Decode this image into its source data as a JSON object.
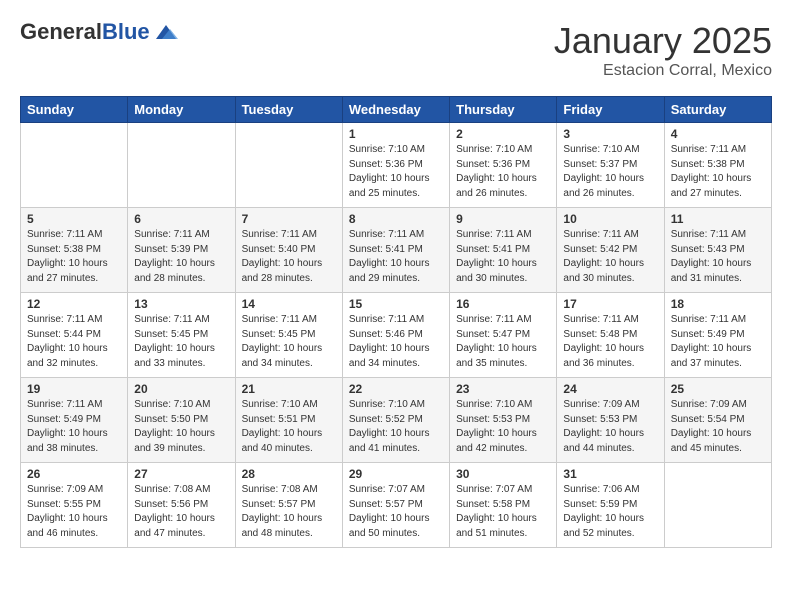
{
  "logo": {
    "general": "General",
    "blue": "Blue"
  },
  "header": {
    "title": "January 2025",
    "subtitle": "Estacion Corral, Mexico"
  },
  "weekdays": [
    "Sunday",
    "Monday",
    "Tuesday",
    "Wednesday",
    "Thursday",
    "Friday",
    "Saturday"
  ],
  "weeks": [
    [
      {
        "day": "",
        "sunrise": "",
        "sunset": "",
        "daylight": ""
      },
      {
        "day": "",
        "sunrise": "",
        "sunset": "",
        "daylight": ""
      },
      {
        "day": "",
        "sunrise": "",
        "sunset": "",
        "daylight": ""
      },
      {
        "day": "1",
        "sunrise": "Sunrise: 7:10 AM",
        "sunset": "Sunset: 5:36 PM",
        "daylight": "Daylight: 10 hours and 25 minutes."
      },
      {
        "day": "2",
        "sunrise": "Sunrise: 7:10 AM",
        "sunset": "Sunset: 5:36 PM",
        "daylight": "Daylight: 10 hours and 26 minutes."
      },
      {
        "day": "3",
        "sunrise": "Sunrise: 7:10 AM",
        "sunset": "Sunset: 5:37 PM",
        "daylight": "Daylight: 10 hours and 26 minutes."
      },
      {
        "day": "4",
        "sunrise": "Sunrise: 7:11 AM",
        "sunset": "Sunset: 5:38 PM",
        "daylight": "Daylight: 10 hours and 27 minutes."
      }
    ],
    [
      {
        "day": "5",
        "sunrise": "Sunrise: 7:11 AM",
        "sunset": "Sunset: 5:38 PM",
        "daylight": "Daylight: 10 hours and 27 minutes."
      },
      {
        "day": "6",
        "sunrise": "Sunrise: 7:11 AM",
        "sunset": "Sunset: 5:39 PM",
        "daylight": "Daylight: 10 hours and 28 minutes."
      },
      {
        "day": "7",
        "sunrise": "Sunrise: 7:11 AM",
        "sunset": "Sunset: 5:40 PM",
        "daylight": "Daylight: 10 hours and 28 minutes."
      },
      {
        "day": "8",
        "sunrise": "Sunrise: 7:11 AM",
        "sunset": "Sunset: 5:41 PM",
        "daylight": "Daylight: 10 hours and 29 minutes."
      },
      {
        "day": "9",
        "sunrise": "Sunrise: 7:11 AM",
        "sunset": "Sunset: 5:41 PM",
        "daylight": "Daylight: 10 hours and 30 minutes."
      },
      {
        "day": "10",
        "sunrise": "Sunrise: 7:11 AM",
        "sunset": "Sunset: 5:42 PM",
        "daylight": "Daylight: 10 hours and 30 minutes."
      },
      {
        "day": "11",
        "sunrise": "Sunrise: 7:11 AM",
        "sunset": "Sunset: 5:43 PM",
        "daylight": "Daylight: 10 hours and 31 minutes."
      }
    ],
    [
      {
        "day": "12",
        "sunrise": "Sunrise: 7:11 AM",
        "sunset": "Sunset: 5:44 PM",
        "daylight": "Daylight: 10 hours and 32 minutes."
      },
      {
        "day": "13",
        "sunrise": "Sunrise: 7:11 AM",
        "sunset": "Sunset: 5:45 PM",
        "daylight": "Daylight: 10 hours and 33 minutes."
      },
      {
        "day": "14",
        "sunrise": "Sunrise: 7:11 AM",
        "sunset": "Sunset: 5:45 PM",
        "daylight": "Daylight: 10 hours and 34 minutes."
      },
      {
        "day": "15",
        "sunrise": "Sunrise: 7:11 AM",
        "sunset": "Sunset: 5:46 PM",
        "daylight": "Daylight: 10 hours and 34 minutes."
      },
      {
        "day": "16",
        "sunrise": "Sunrise: 7:11 AM",
        "sunset": "Sunset: 5:47 PM",
        "daylight": "Daylight: 10 hours and 35 minutes."
      },
      {
        "day": "17",
        "sunrise": "Sunrise: 7:11 AM",
        "sunset": "Sunset: 5:48 PM",
        "daylight": "Daylight: 10 hours and 36 minutes."
      },
      {
        "day": "18",
        "sunrise": "Sunrise: 7:11 AM",
        "sunset": "Sunset: 5:49 PM",
        "daylight": "Daylight: 10 hours and 37 minutes."
      }
    ],
    [
      {
        "day": "19",
        "sunrise": "Sunrise: 7:11 AM",
        "sunset": "Sunset: 5:49 PM",
        "daylight": "Daylight: 10 hours and 38 minutes."
      },
      {
        "day": "20",
        "sunrise": "Sunrise: 7:10 AM",
        "sunset": "Sunset: 5:50 PM",
        "daylight": "Daylight: 10 hours and 39 minutes."
      },
      {
        "day": "21",
        "sunrise": "Sunrise: 7:10 AM",
        "sunset": "Sunset: 5:51 PM",
        "daylight": "Daylight: 10 hours and 40 minutes."
      },
      {
        "day": "22",
        "sunrise": "Sunrise: 7:10 AM",
        "sunset": "Sunset: 5:52 PM",
        "daylight": "Daylight: 10 hours and 41 minutes."
      },
      {
        "day": "23",
        "sunrise": "Sunrise: 7:10 AM",
        "sunset": "Sunset: 5:53 PM",
        "daylight": "Daylight: 10 hours and 42 minutes."
      },
      {
        "day": "24",
        "sunrise": "Sunrise: 7:09 AM",
        "sunset": "Sunset: 5:53 PM",
        "daylight": "Daylight: 10 hours and 44 minutes."
      },
      {
        "day": "25",
        "sunrise": "Sunrise: 7:09 AM",
        "sunset": "Sunset: 5:54 PM",
        "daylight": "Daylight: 10 hours and 45 minutes."
      }
    ],
    [
      {
        "day": "26",
        "sunrise": "Sunrise: 7:09 AM",
        "sunset": "Sunset: 5:55 PM",
        "daylight": "Daylight: 10 hours and 46 minutes."
      },
      {
        "day": "27",
        "sunrise": "Sunrise: 7:08 AM",
        "sunset": "Sunset: 5:56 PM",
        "daylight": "Daylight: 10 hours and 47 minutes."
      },
      {
        "day": "28",
        "sunrise": "Sunrise: 7:08 AM",
        "sunset": "Sunset: 5:57 PM",
        "daylight": "Daylight: 10 hours and 48 minutes."
      },
      {
        "day": "29",
        "sunrise": "Sunrise: 7:07 AM",
        "sunset": "Sunset: 5:57 PM",
        "daylight": "Daylight: 10 hours and 50 minutes."
      },
      {
        "day": "30",
        "sunrise": "Sunrise: 7:07 AM",
        "sunset": "Sunset: 5:58 PM",
        "daylight": "Daylight: 10 hours and 51 minutes."
      },
      {
        "day": "31",
        "sunrise": "Sunrise: 7:06 AM",
        "sunset": "Sunset: 5:59 PM",
        "daylight": "Daylight: 10 hours and 52 minutes."
      },
      {
        "day": "",
        "sunrise": "",
        "sunset": "",
        "daylight": ""
      }
    ]
  ]
}
